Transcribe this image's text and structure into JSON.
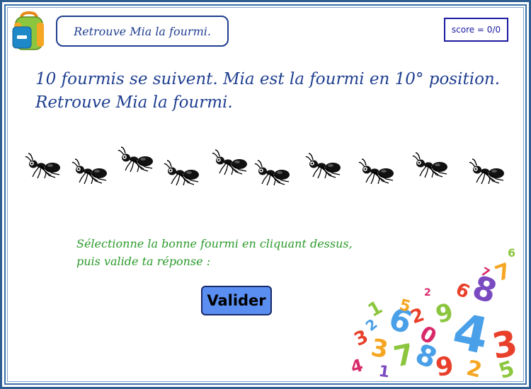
{
  "header": {
    "title": "Retrouve Mia la fourmi.",
    "score": "score = 0/0",
    "backpack_icon": "backpack-icon"
  },
  "question": {
    "line1": "10 fourmis se suivent. Mia est la fourmi en 10° position.",
    "line2": "Retrouve Mia la fourmi."
  },
  "ants": {
    "count": 10,
    "icon": "ant-icon"
  },
  "instructions": {
    "line1": "Sélectionne la bonne fourmi en cliquant dessus,",
    "line2": "puis valide ta réponse :"
  },
  "button": {
    "label": "Valider",
    "color": "#5a8ef0"
  },
  "decor": {
    "numbers_icon": "numbers-pile-decoration",
    "digits": [
      "6",
      "4",
      "5",
      "8",
      "2",
      "7",
      "3",
      "1",
      "9",
      "0"
    ]
  },
  "colors": {
    "frame": "#2e5d91",
    "title": "#1f3f8f",
    "instructions": "#2a9a2a"
  }
}
